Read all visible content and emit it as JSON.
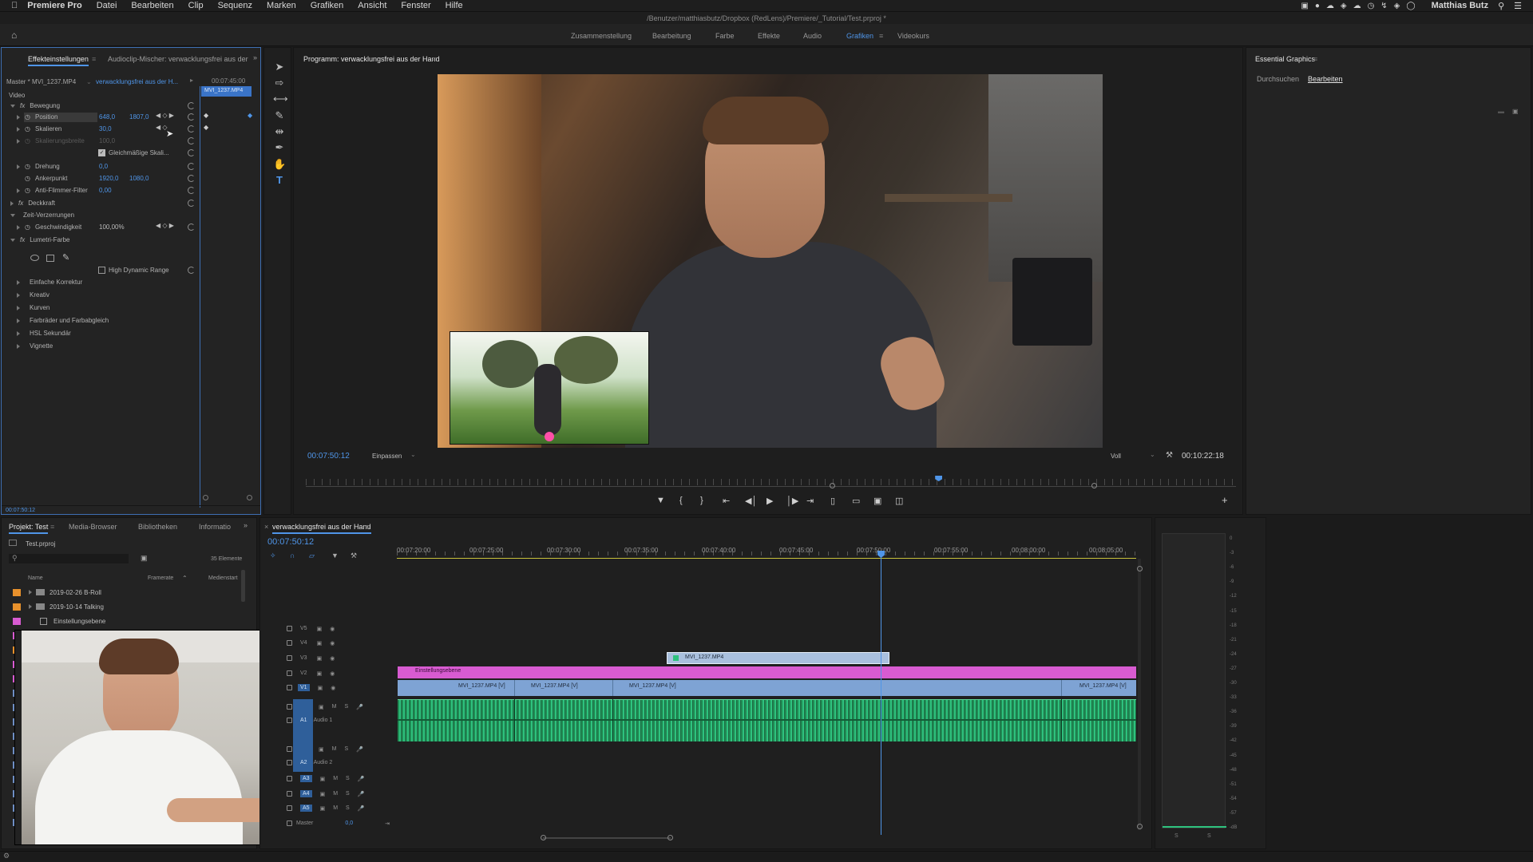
{
  "menubar": {
    "app": "Premiere Pro",
    "items": [
      "Datei",
      "Bearbeiten",
      "Clip",
      "Sequenz",
      "Marken",
      "Grafiken",
      "Ansicht",
      "Fenster",
      "Hilfe"
    ],
    "user": "Matthias Butz"
  },
  "titlebar": {
    "path": "/Benutzer/matthiasbutz/Dropbox (RedLens)/Premiere/_Tutorial/Test.prproj *"
  },
  "workspaces": {
    "items": [
      "Zusammenstellung",
      "Bearbeitung",
      "Farbe",
      "Effekte",
      "Audio",
      "Grafiken",
      "Videokurs"
    ],
    "active": "Grafiken"
  },
  "effects_panel": {
    "tab_active": "Effekteinstellungen",
    "tab_other": "Audioclip-Mischer: verwacklungsfrei aus der",
    "master": "Master * MVI_1237.MP4",
    "clip_link": "verwacklungsfrei aus der H...",
    "timecode_top": "00:07:45:00",
    "clip_chip": "MVI_1237.MP4",
    "section_video": "Video",
    "bewegung": "Bewegung",
    "position_label": "Position",
    "position_x": "648,0",
    "position_y": "1807,0",
    "skalieren_label": "Skalieren",
    "skalieren_val": "30,0",
    "skal_breite_label": "Skalierungsbreite",
    "skal_breite_val": "100,0",
    "gleich_label": "Gleichmäßige Skali...",
    "drehung_label": "Drehung",
    "drehung_val": "0,0",
    "anker_label": "Ankerpunkt",
    "anker_x": "1920,0",
    "anker_y": "1080,0",
    "flimmer_label": "Anti-Flimmer-Filter",
    "flimmer_val": "0,00",
    "deckkraft": "Deckkraft",
    "zeit": "Zeit-Verzerrungen",
    "geschw_label": "Geschwindigkeit",
    "geschw_val": "100,00%",
    "lumetri": "Lumetri-Farbe",
    "hdr": "High Dynamic Range",
    "lumetri_items": [
      "Einfache Korrektur",
      "Kreativ",
      "Kurven",
      "Farbräder und Farbabgleich",
      "HSL Sekundär",
      "Vignette"
    ],
    "timecode_bottom": "00:07:50:12"
  },
  "program": {
    "title": "Programm: verwacklungsfrei aus der Hand",
    "timecode": "00:07:50:12",
    "fit": "Einpassen",
    "quality": "Voll",
    "duration": "00:10:22:18",
    "playhead_progress": 0.68
  },
  "essential": {
    "title": "Essential Graphics",
    "tab_browse": "Durchsuchen",
    "tab_edit": "Bearbeiten"
  },
  "project": {
    "tabs": [
      "Projekt: Test",
      "Media-Browser",
      "Bibliotheken",
      "Informatio"
    ],
    "file": "Test.prproj",
    "count": "35 Elemente",
    "col_name": "Name",
    "col_rate": "Framerate",
    "col_start": "Medienstart",
    "items": [
      {
        "name": "2019-02-26 B-Roll",
        "color": "#e8912c"
      },
      {
        "name": "2019-10-14 Talking",
        "color": "#e8912c"
      },
      {
        "name": "Einstellungsebene",
        "color": "#d85bd1"
      }
    ]
  },
  "timeline": {
    "seq_name": "verwacklungsfrei aus der Hand",
    "timecode": "00:07:50:12",
    "ruler": [
      "00:07:20:00",
      "00:07:25:00",
      "00:07:30:00",
      "00:07:35:00",
      "00:07:40:00",
      "00:07:45:00",
      "00:07:50:00",
      "00:07:55:00",
      "00:08:00:00",
      "00:08:05:00"
    ],
    "video_tracks": [
      "V5",
      "V4",
      "V3",
      "V2",
      "V1"
    ],
    "audio_tracks": [
      "A1",
      "A2",
      "A3",
      "A4",
      "A5"
    ],
    "audio1": "Audio 1",
    "audio2": "Audio 2",
    "master": "Master",
    "master_val": "0,0",
    "clip_v3": "MVI_1237.MP4",
    "clip_adj": "Einstellungsebene",
    "v1_clips": [
      "MVI_1237.MP4 [V]",
      "MVI_1237.MP4 [V]",
      "MVI_1237.MP4 [V]",
      "MVI_1237.MP4 [V]"
    ]
  },
  "meter": {
    "labels": [
      "0",
      "-3",
      "-6",
      "-9",
      "-12",
      "-15",
      "-18",
      "-21",
      "-24",
      "-27",
      "-30",
      "-33",
      "-36",
      "-39",
      "-42",
      "-45",
      "-48",
      "-51",
      "-54",
      "-57",
      "-dB"
    ],
    "bottom": [
      "S",
      "S"
    ]
  },
  "colors": {
    "accent": "#4f95e8",
    "adjustment": "#d85bd1",
    "video_clip": "#7ea3d4",
    "audio_clip": "#2ec27e"
  }
}
